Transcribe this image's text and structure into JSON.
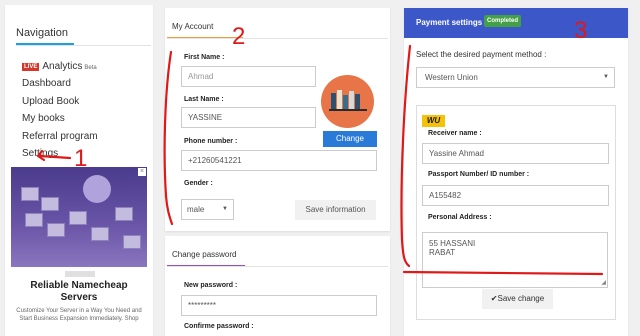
{
  "navigation": {
    "title": "Navigation",
    "live_badge": "LIVE",
    "items": [
      {
        "label": "Analytics",
        "suffix": "Beta"
      },
      {
        "label": "Dashboard"
      },
      {
        "label": "Upload Book"
      },
      {
        "label": "My books"
      },
      {
        "label": "Referral program"
      },
      {
        "label": "Settings"
      }
    ]
  },
  "ad": {
    "title": "Reliable Namecheap Servers",
    "description": "Customize Your Server in a Way You Need and Start Business Expansion Immediately. Shop"
  },
  "account": {
    "title": "My Account",
    "fields": {
      "first_name": {
        "label": "First Name :",
        "placeholder": "Ahmad"
      },
      "last_name": {
        "label": "Last Name :",
        "value": "YASSINE"
      },
      "phone": {
        "label": "Phone number :",
        "value": "+21260541221"
      },
      "gender": {
        "label": "Gender :",
        "value": "male"
      }
    },
    "change_photo_label": "Change",
    "save_label": "Save information"
  },
  "password": {
    "title": "Change password",
    "new_label": "New password :",
    "new_value": "*********",
    "confirm_label": "Confirme password :"
  },
  "payment": {
    "title": "Payment settings",
    "status_badge": "Completed",
    "prompt": "Select the desired payment method :",
    "method": "Western Union",
    "logo_text": "WU",
    "receiver_label": "Receiver name :",
    "receiver_value": "Yassine Ahmad",
    "passport_label": "Passport Number/ ID number :",
    "passport_value": "A155482",
    "address_label": "Personal Address :",
    "address_lines": [
      "55 HASSANI",
      "RABAT"
    ],
    "save_label": "Save change"
  },
  "annotations": [
    "1",
    "2",
    "3"
  ],
  "colors": {
    "accent_blue": "#2a7bd8",
    "nav_underline": "#20a0d8",
    "payment_header": "#3c58c8",
    "completed_green": "#43a047",
    "account_tab_underline": "#e8a33d",
    "password_tab_underline": "#9b4fc4",
    "live_red": "#d9352b",
    "annotation_red": "#e01818"
  }
}
